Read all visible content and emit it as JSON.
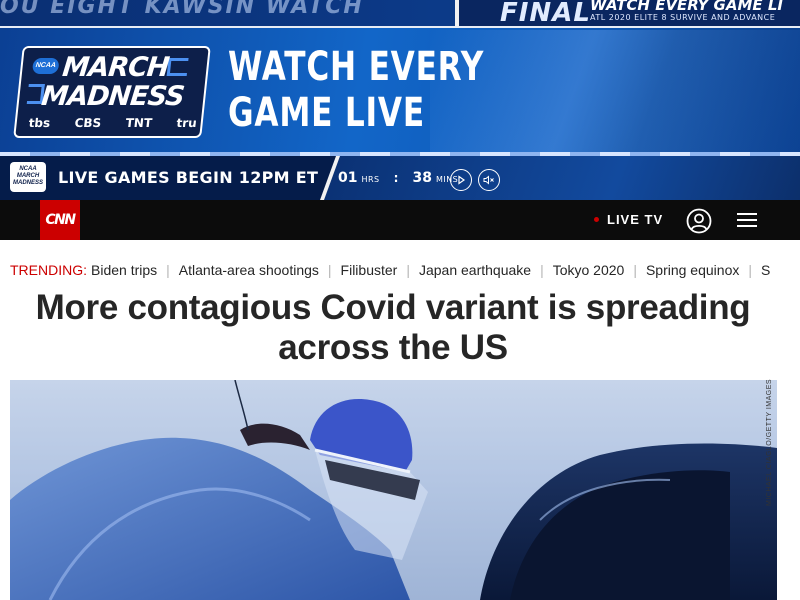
{
  "ad": {
    "top_strip_left": "OU EIGHT   KAWSIN WATCH",
    "top_strip_final": "FINAL",
    "top_strip_watch": "WATCH EVERY GAME LI",
    "top_strip_sub": "ATL 2020 ELITE 8  SURVIVE AND ADVANCE",
    "logo_badge": "NCAA",
    "logo_line1": "MARCH",
    "logo_line2": "MADNESS",
    "networks": [
      "tbs",
      "CBS",
      "TNT",
      "tru"
    ],
    "headline_line1": "WATCH EVERY",
    "headline_line2": "GAME LIVE",
    "mini_logo": "NCAA MARCH MADNESS",
    "live_games_text": "LIVE GAMES BEGIN 12PM ET",
    "countdown": {
      "hours_value": "01",
      "hours_unit": "HRS",
      "mins_value": "38",
      "mins_unit": "MINS"
    },
    "colors": {
      "primary_blue": "#1266c8",
      "dark_navy": "#051c4a"
    }
  },
  "nav": {
    "logo_text": "CNN",
    "live_tv_label": "LIVE TV",
    "icons": [
      "user-icon",
      "menu-icon"
    ],
    "colors": {
      "brand_red": "#cc0000",
      "bar": "#0c0c0c"
    }
  },
  "trending": {
    "label": "TRENDING:",
    "items": [
      "Biden trips",
      "Atlanta-area shootings",
      "Filibuster",
      "Japan earthquake",
      "Tokyo 2020",
      "Spring equinox",
      "S"
    ]
  },
  "article": {
    "headline_line1": "More contagious Covid variant is spreading",
    "headline_line2": "across the US",
    "photo_credit": "MICHAEL CIAGLO/GETTY IMAGES"
  }
}
